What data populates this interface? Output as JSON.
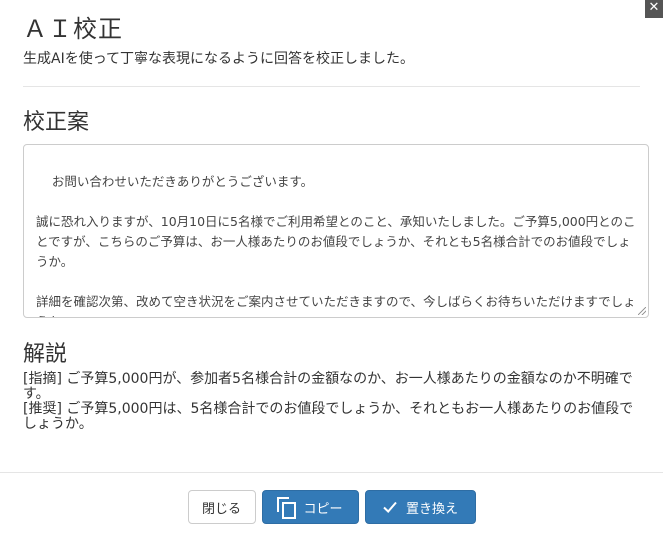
{
  "dialog": {
    "close_glyph": "✕",
    "title": "ＡＩ校正",
    "subtitle": "生成AIを使って丁寧な表現になるように回答を校正しました。"
  },
  "proposal": {
    "heading": "校正案",
    "text": "お問い合わせいただきありがとうございます。\n\n誠に恐れ入りますが、10月10日に5名様でご利用希望とのこと、承知いたしました。ご予算5,000円とのことですが、こちらのご予算は、お一人様あたりのお値段でしょうか、それとも5名様合計でのお値段でしょうか。\n\n詳細を確認次第、改めて空き状況をご案内させていただきますので、今しばらくお待ちいただけますでしょうか。"
  },
  "explanation": {
    "heading": "解説",
    "lines": [
      "[指摘] ご予算5,000円が、参加者5名様合計の金額なのか、お一人様あたりの金額なのか不明確です。",
      "[推奨] ご予算5,000円は、5名様合計でのお値段でしょうか、それともお一人様あたりのお値段でしょうか。"
    ]
  },
  "footer": {
    "close_label": "閉じる",
    "copy_label": "コピー",
    "replace_label": "置き換え",
    "copy_icon": "copy-icon",
    "replace_icon": "check-icon"
  },
  "colors": {
    "primary": "#337ab7",
    "primary_border": "#2e6da4",
    "text": "#333333"
  }
}
